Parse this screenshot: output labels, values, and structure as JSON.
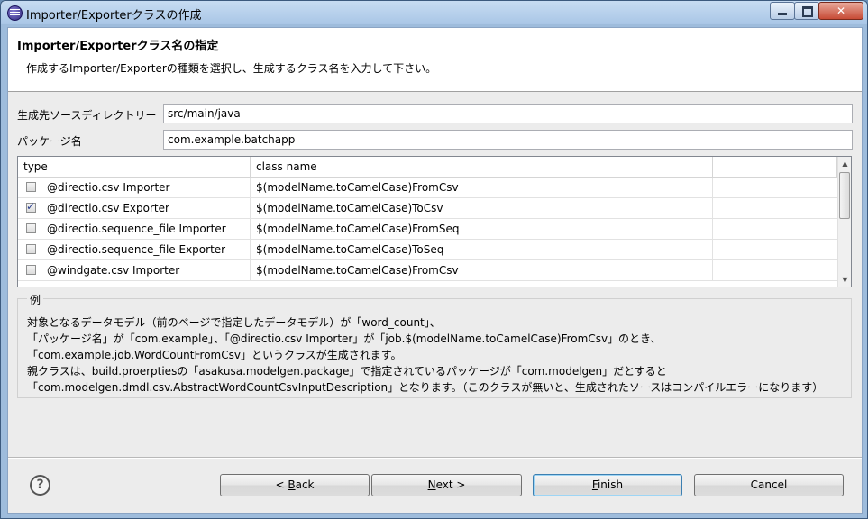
{
  "window": {
    "title": "Importer/Exporterクラスの作成"
  },
  "header": {
    "title": "Importer/Exporterクラス名の指定",
    "description": "作成するImporter/Exporterの種類を選択し、生成するクラス名を入力して下さい。"
  },
  "form": {
    "source_dir_label": "生成先ソースディレクトリー",
    "source_dir_value": "src/main/java",
    "package_label": "パッケージ名",
    "package_value": "com.example.batchapp"
  },
  "table": {
    "columns": [
      "type",
      "class name"
    ],
    "rows": [
      {
        "type": "@directio.csv Importer",
        "class_name": "$(modelName.toCamelCase)FromCsv",
        "checked": false
      },
      {
        "type": "@directio.csv Exporter",
        "class_name": "$(modelName.toCamelCase)ToCsv",
        "checked": true
      },
      {
        "type": "@directio.sequence_file Importer",
        "class_name": "$(modelName.toCamelCase)FromSeq",
        "checked": false
      },
      {
        "type": "@directio.sequence_file Exporter",
        "class_name": "$(modelName.toCamelCase)ToSeq",
        "checked": false
      },
      {
        "type": "@windgate.csv Importer",
        "class_name": "$(modelName.toCamelCase)FromCsv",
        "checked": false
      }
    ]
  },
  "example": {
    "title": "例",
    "lines": [
      "対象となるデータモデル（前のページで指定したデータモデル）が「word_count」、",
      "「パッケージ名」が「com.example」、「@directio.csv Importer」が「job.$(modelName.toCamelCase)FromCsv」のとき、",
      "「com.example.job.WordCountFromCsv」というクラスが生成されます。",
      "親クラスは、build.proerptiesの「asakusa.modelgen.package」で指定されているパッケージが「com.modelgen」だとすると",
      "「com.modelgen.dmdl.csv.AbstractWordCountCsvInputDescription」となります。（このクラスが無いと、生成されたソースはコンパイルエラーになります）"
    ]
  },
  "buttons": {
    "help": "?",
    "back_prefix": "< ",
    "back_mnemonic": "B",
    "back_rest": "ack",
    "next_mnemonic": "N",
    "next_rest": "ext >",
    "finish_mnemonic": "F",
    "finish_rest": "inish",
    "cancel": "Cancel"
  }
}
